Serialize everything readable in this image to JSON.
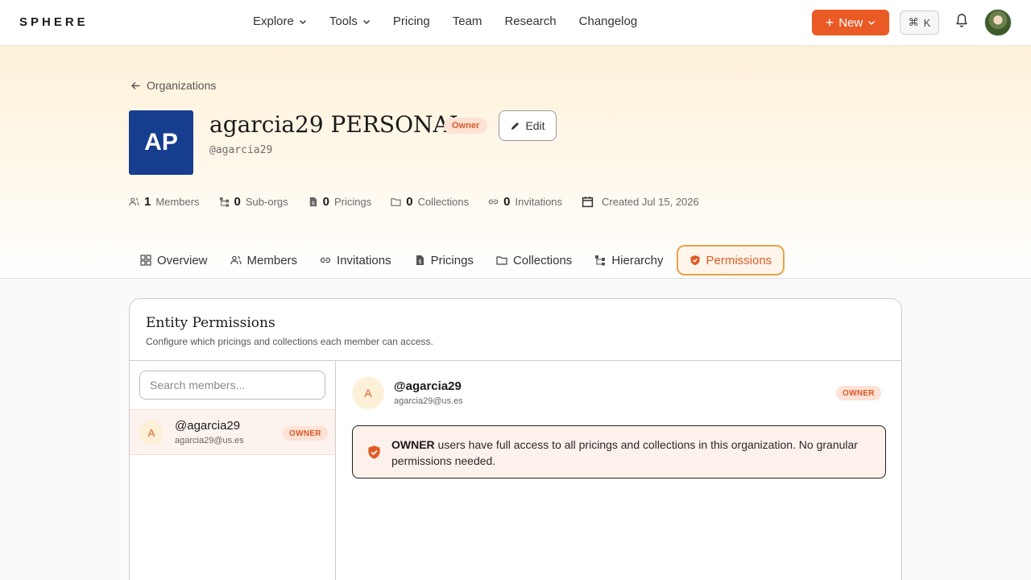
{
  "nav": {
    "logo": "SPHERE",
    "links": [
      {
        "label": "Explore",
        "dropdown": true
      },
      {
        "label": "Tools",
        "dropdown": true
      },
      {
        "label": "Pricing",
        "dropdown": false
      },
      {
        "label": "Team",
        "dropdown": false
      },
      {
        "label": "Research",
        "dropdown": false
      },
      {
        "label": "Changelog",
        "dropdown": false
      }
    ],
    "new_label": "New",
    "shortcut_key": "K",
    "accent_color": "#ea5a25"
  },
  "org": {
    "breadcrumb": "Organizations",
    "initials": "AP",
    "name": "agarcia29 PERSONAL",
    "role_badge": "Owner",
    "edit_label": "Edit",
    "handle": "@agarcia29",
    "stats": [
      {
        "value": "1",
        "label": "Members",
        "icon": "users-icon"
      },
      {
        "value": "0",
        "label": "Sub-orgs",
        "icon": "hierarchy-icon"
      },
      {
        "value": "0",
        "label": "Pricings",
        "icon": "file-dollar-icon"
      },
      {
        "value": "0",
        "label": "Collections",
        "icon": "folder-icon"
      },
      {
        "value": "0",
        "label": "Invitations",
        "icon": "link-icon"
      }
    ],
    "created": "Created Jul 15, 2026"
  },
  "tabs": [
    {
      "label": "Overview",
      "icon": "grid-icon",
      "active": false
    },
    {
      "label": "Members",
      "icon": "users-icon",
      "active": false
    },
    {
      "label": "Invitations",
      "icon": "link-icon",
      "active": false
    },
    {
      "label": "Pricings",
      "icon": "file-dollar-icon",
      "active": false
    },
    {
      "label": "Collections",
      "icon": "folder-icon",
      "active": false
    },
    {
      "label": "Hierarchy",
      "icon": "hierarchy-icon",
      "active": false
    },
    {
      "label": "Permissions",
      "icon": "shield-icon",
      "active": true
    }
  ],
  "permissions": {
    "title": "Entity Permissions",
    "subtitle": "Configure which pricings and collections each member can access.",
    "search_placeholder": "Search members...",
    "members": [
      {
        "initial": "A",
        "username": "@agarcia29",
        "email": "agarcia29@us.es",
        "role": "OWNER"
      }
    ],
    "selected": {
      "initial": "A",
      "username": "@agarcia29",
      "email": "agarcia29@us.es",
      "role": "OWNER"
    },
    "notice_strong": "OWNER",
    "notice_text": " users have full access to all pricings and collections in this organization. No granular permissions needed."
  }
}
